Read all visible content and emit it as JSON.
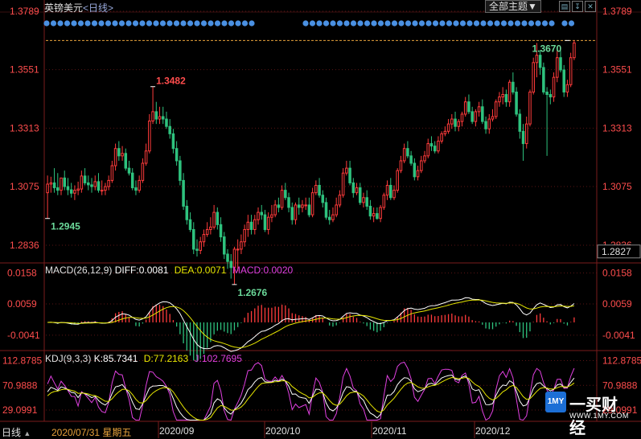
{
  "header": {
    "title": "英镑美元",
    "period": "<日线>",
    "theme_button": "全部主题▼",
    "icon_labels": [
      "▤",
      "↧",
      "✕"
    ]
  },
  "timebar": {
    "corner_label": "日线",
    "cursor_date": "2020/07/31 星期五",
    "months": [
      "2020/09",
      "2020/10",
      "2020/11",
      "2020/12"
    ]
  },
  "macd": {
    "label": "MACD(26,12,9)",
    "diff_text": "DIFF:0.0081",
    "dea_text": "DEA:0.0071",
    "macd_text": "MACD:0.0020"
  },
  "kdj": {
    "label": "KDJ(9,3,3)",
    "k_text": "K:85.7341",
    "d_text": "D:77.2163",
    "j_text": "J:102.7695"
  },
  "logo": {
    "text": "一买财经",
    "url": "WWW.1MY.COM",
    "mark": "1MY"
  },
  "colors": {
    "up": "#ff3b3b",
    "down": "#2ec27e",
    "macd_diff": "#ffffff",
    "macd_dea": "#e6e600",
    "macd_hist_text": "#e040e0",
    "axis_text": "#ff4d4d",
    "grid": "#5a1414",
    "marker": "#4a90e2"
  },
  "chart_data": [
    {
      "type": "candlestick",
      "title": "英镑美元",
      "ylim": [
        1.2764,
        1.3789
      ],
      "yticks": [
        1.3789,
        1.3551,
        1.3313,
        1.3075,
        1.2836
      ],
      "ytick_labels": [
        "1.3789",
        "1.3551",
        "1.3313",
        "1.3075",
        "1.2836"
      ],
      "last_price": 1.2827,
      "last_price_label": "1.2827",
      "annotations": [
        {
          "label": "1.3482",
          "value": 1.3482,
          "index": 31
        },
        {
          "label": "1.2945",
          "value": 1.2945,
          "index": 0
        },
        {
          "label": "1.2676",
          "value": 1.2676,
          "index": 55
        },
        {
          "label": "1.3670",
          "value": 1.367,
          "index": 153
        }
      ],
      "reference_line": 1.367,
      "start_date": "2020-07-31",
      "open": [
        1.305,
        1.3085,
        1.309,
        1.307,
        1.306,
        1.311,
        1.3075,
        1.3062,
        1.3048,
        1.306,
        1.3065,
        1.3118,
        1.309,
        1.3082,
        1.3075,
        1.3095,
        1.306,
        1.306,
        1.3075,
        1.31,
        1.316,
        1.323,
        1.32,
        1.321,
        1.315,
        1.313,
        1.307,
        1.306,
        1.31,
        1.317,
        1.322,
        1.3342,
        1.338,
        1.335,
        1.336,
        1.335,
        1.332,
        1.329,
        1.323,
        1.318,
        1.31,
        1.2995,
        1.294,
        1.29,
        1.282,
        1.2815,
        1.285,
        1.288,
        1.29,
        1.291,
        1.297,
        1.292,
        1.287,
        1.28,
        1.277,
        1.2745,
        1.282,
        1.282,
        1.285,
        1.29,
        1.293,
        1.29,
        1.294,
        1.297,
        1.296,
        1.29,
        1.295,
        1.296,
        1.3,
        1.299,
        1.306,
        1.303,
        1.299,
        1.294,
        1.3,
        1.299,
        1.3,
        1.3,
        1.296,
        1.305,
        1.308,
        1.304,
        1.301,
        1.295,
        1.294,
        1.296,
        1.3,
        1.304,
        1.313,
        1.315,
        1.309,
        1.305,
        1.307,
        1.301,
        1.303,
        1.2995,
        1.2955,
        1.2965,
        1.2945,
        1.299,
        1.304,
        1.308,
        1.303,
        1.306,
        1.314,
        1.318,
        1.323,
        1.32,
        1.317,
        1.3115,
        1.314,
        1.318,
        1.32,
        1.325,
        1.324,
        1.322,
        1.326,
        1.329,
        1.33,
        1.333,
        1.335,
        1.332,
        1.334,
        1.337,
        1.342,
        1.338,
        1.334,
        1.338,
        1.34,
        1.334,
        1.331,
        1.335,
        1.336,
        1.342,
        1.344,
        1.345,
        1.342,
        1.35,
        1.346,
        1.337,
        1.33,
        1.325,
        1.333,
        1.346,
        1.358,
        1.361,
        1.356,
        1.346,
        1.345,
        1.344,
        1.352,
        1.36,
        1.355,
        1.346,
        1.349,
        1.36
      ],
      "high": [
        1.312,
        1.3115,
        1.315,
        1.313,
        1.31,
        1.314,
        1.311,
        1.309,
        1.308,
        1.3095,
        1.314,
        1.315,
        1.312,
        1.311,
        1.312,
        1.313,
        1.31,
        1.309,
        1.312,
        1.318,
        1.325,
        1.326,
        1.324,
        1.323,
        1.318,
        1.315,
        1.31,
        1.312,
        1.319,
        1.325,
        1.337,
        1.3482,
        1.342,
        1.34,
        1.34,
        1.338,
        1.335,
        1.331,
        1.326,
        1.32,
        1.313,
        1.302,
        1.297,
        1.293,
        1.286,
        1.287,
        1.29,
        1.293,
        1.295,
        1.3,
        1.299,
        1.295,
        1.289,
        1.282,
        1.28,
        1.283,
        1.286,
        1.288,
        1.292,
        1.296,
        1.296,
        1.296,
        1.299,
        1.3,
        1.298,
        1.297,
        1.3,
        1.302,
        1.303,
        1.308,
        1.309,
        1.305,
        1.301,
        1.301,
        1.303,
        1.302,
        1.303,
        1.303,
        1.307,
        1.31,
        1.311,
        1.306,
        1.303,
        1.298,
        1.299,
        1.303,
        1.306,
        1.315,
        1.318,
        1.318,
        1.311,
        1.309,
        1.309,
        1.305,
        1.306,
        1.302,
        1.299,
        1.299,
        1.3,
        1.305,
        1.31,
        1.311,
        1.308,
        1.315,
        1.32,
        1.325,
        1.326,
        1.322,
        1.319,
        1.316,
        1.32,
        1.322,
        1.327,
        1.328,
        1.326,
        1.328,
        1.33,
        1.332,
        1.335,
        1.337,
        1.338,
        1.335,
        1.338,
        1.344,
        1.345,
        1.34,
        1.339,
        1.342,
        1.343,
        1.336,
        1.337,
        1.339,
        1.343,
        1.346,
        1.348,
        1.347,
        1.351,
        1.354,
        1.348,
        1.339,
        1.333,
        1.336,
        1.347,
        1.36,
        1.366,
        1.363,
        1.358,
        1.348,
        1.347,
        1.354,
        1.363,
        1.363,
        1.357,
        1.351,
        1.362,
        1.367
      ],
      "low": [
        1.2945,
        1.305,
        1.305,
        1.304,
        1.304,
        1.306,
        1.304,
        1.303,
        1.302,
        1.304,
        1.305,
        1.308,
        1.306,
        1.305,
        1.306,
        1.305,
        1.304,
        1.304,
        1.306,
        1.309,
        1.314,
        1.318,
        1.318,
        1.314,
        1.312,
        1.306,
        1.304,
        1.305,
        1.309,
        1.316,
        1.321,
        1.333,
        1.333,
        1.333,
        1.333,
        1.331,
        1.327,
        1.321,
        1.316,
        1.308,
        1.298,
        1.292,
        1.289,
        1.28,
        1.279,
        1.28,
        1.283,
        1.287,
        1.288,
        1.29,
        1.29,
        1.285,
        1.278,
        1.274,
        1.27,
        1.2676,
        1.273,
        1.28,
        1.283,
        1.287,
        1.288,
        1.288,
        1.292,
        1.294,
        1.289,
        1.288,
        1.293,
        1.295,
        1.297,
        1.298,
        1.302,
        1.297,
        1.292,
        1.292,
        1.296,
        1.297,
        1.298,
        1.295,
        1.295,
        1.304,
        1.303,
        1.299,
        1.294,
        1.292,
        1.293,
        1.295,
        1.299,
        1.303,
        1.312,
        1.308,
        1.303,
        1.304,
        1.3,
        1.299,
        1.298,
        1.294,
        1.293,
        1.294,
        1.293,
        1.298,
        1.302,
        1.302,
        1.302,
        1.305,
        1.313,
        1.317,
        1.319,
        1.316,
        1.31,
        1.31,
        1.313,
        1.317,
        1.319,
        1.322,
        1.321,
        1.321,
        1.325,
        1.328,
        1.329,
        1.331,
        1.33,
        1.33,
        1.332,
        1.336,
        1.337,
        1.333,
        1.332,
        1.336,
        1.333,
        1.329,
        1.329,
        1.334,
        1.335,
        1.34,
        1.341,
        1.34,
        1.34,
        1.345,
        1.336,
        1.327,
        1.318,
        1.323,
        1.332,
        1.345,
        1.352,
        1.353,
        1.345,
        1.32,
        1.341,
        1.342,
        1.35,
        1.354,
        1.344,
        1.344,
        1.348,
        1.359
      ],
      "close": [
        1.3085,
        1.309,
        1.307,
        1.306,
        1.311,
        1.3075,
        1.3062,
        1.3048,
        1.306,
        1.3065,
        1.3118,
        1.309,
        1.3082,
        1.3075,
        1.3095,
        1.306,
        1.306,
        1.3075,
        1.31,
        1.316,
        1.323,
        1.32,
        1.321,
        1.315,
        1.313,
        1.307,
        1.306,
        1.31,
        1.317,
        1.322,
        1.3342,
        1.338,
        1.335,
        1.336,
        1.335,
        1.332,
        1.329,
        1.323,
        1.318,
        1.31,
        1.2995,
        1.294,
        1.29,
        1.282,
        1.2815,
        1.285,
        1.288,
        1.29,
        1.291,
        1.297,
        1.292,
        1.287,
        1.28,
        1.277,
        1.2745,
        1.282,
        1.282,
        1.285,
        1.29,
        1.293,
        1.29,
        1.294,
        1.297,
        1.296,
        1.29,
        1.295,
        1.296,
        1.3,
        1.299,
        1.306,
        1.303,
        1.299,
        1.294,
        1.3,
        1.299,
        1.3,
        1.3,
        1.296,
        1.305,
        1.308,
        1.304,
        1.301,
        1.295,
        1.294,
        1.296,
        1.3,
        1.304,
        1.313,
        1.315,
        1.309,
        1.305,
        1.307,
        1.301,
        1.303,
        1.2995,
        1.2955,
        1.2965,
        1.2945,
        1.299,
        1.304,
        1.308,
        1.303,
        1.306,
        1.314,
        1.318,
        1.323,
        1.32,
        1.317,
        1.3115,
        1.314,
        1.318,
        1.32,
        1.325,
        1.324,
        1.322,
        1.326,
        1.329,
        1.33,
        1.333,
        1.335,
        1.332,
        1.334,
        1.337,
        1.342,
        1.338,
        1.334,
        1.338,
        1.34,
        1.334,
        1.331,
        1.335,
        1.336,
        1.342,
        1.344,
        1.345,
        1.342,
        1.35,
        1.346,
        1.337,
        1.33,
        1.325,
        1.333,
        1.346,
        1.358,
        1.361,
        1.356,
        1.346,
        1.345,
        1.344,
        1.352,
        1.36,
        1.355,
        1.346,
        1.349,
        1.36,
        1.366
      ]
    },
    {
      "type": "macd",
      "title": "MACD(26,12,9)",
      "ylim": [
        -0.009,
        0.019
      ],
      "yticks": [
        0.0158,
        0.0059,
        -0.0041
      ],
      "ytick_labels": [
        "0.0158",
        "0.0059",
        "-0.0041"
      ]
    },
    {
      "type": "kdj",
      "title": "KDJ(9,3,3)",
      "ylim": [
        10,
        130
      ],
      "yticks": [
        112.8785,
        70.9888,
        29.0991
      ],
      "ytick_labels": [
        "112.8785",
        "70.9888",
        "29.0991"
      ]
    }
  ]
}
